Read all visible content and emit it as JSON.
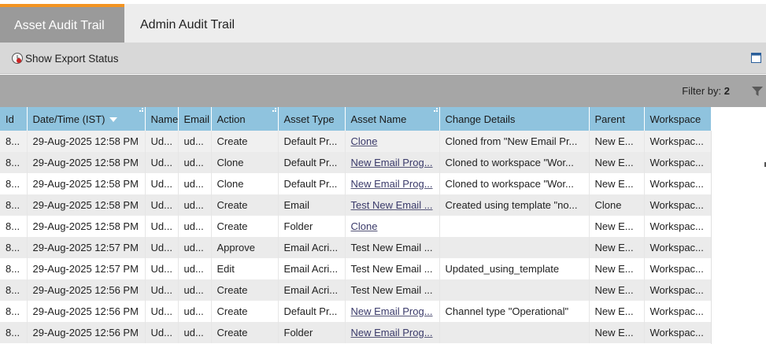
{
  "tabs": [
    {
      "label": "Asset Audit Trail",
      "active": true
    },
    {
      "label": "Admin Audit Trail",
      "active": false
    }
  ],
  "toolbar": {
    "export_label": "Show Export Status",
    "export_icon": "export-status-icon",
    "window_icon": "maximize-window-icon"
  },
  "filter": {
    "label": "Filter by:",
    "count": "2",
    "icon": "funnel-icon"
  },
  "colors": {
    "accent": "#f39421",
    "active_tab": "#9a9a9a",
    "header": "#8fc3de"
  },
  "grid": {
    "columns": [
      "Id",
      "Date/Time (IST)",
      "Name",
      "Email",
      "Action",
      "Asset Type",
      "Asset Name",
      "Change Details",
      "Parent",
      "Workspace"
    ],
    "sorted_column": "Date/Time (IST)",
    "rows": [
      {
        "id": "8...",
        "datetime": "29-Aug-2025 12:58 PM",
        "name": "Ud...",
        "email": "ud...",
        "action": "Create",
        "asset_type": "Default Pr...",
        "asset_name": "Clone",
        "asset_link": true,
        "change": "Cloned from \"New Email Pr...",
        "parent": "New E...",
        "workspace": "Workspac..."
      },
      {
        "id": "8...",
        "datetime": "29-Aug-2025 12:58 PM",
        "name": "Ud...",
        "email": "ud...",
        "action": "Clone",
        "asset_type": "Default Pr...",
        "asset_name": "New Email Prog...",
        "asset_link": true,
        "change": "Cloned to workspace \"Wor...",
        "parent": "New E...",
        "workspace": "Workspac..."
      },
      {
        "id": "8...",
        "datetime": "29-Aug-2025 12:58 PM",
        "name": "Ud...",
        "email": "ud...",
        "action": "Clone",
        "asset_type": "Default Pr...",
        "asset_name": "New Email Prog...",
        "asset_link": true,
        "change": "Cloned to workspace \"Wor...",
        "parent": "New E...",
        "workspace": "Workspac..."
      },
      {
        "id": "8...",
        "datetime": "29-Aug-2025 12:58 PM",
        "name": "Ud...",
        "email": "ud...",
        "action": "Create",
        "asset_type": "Email",
        "asset_name": "Test New Email ...",
        "asset_link": true,
        "change": "Created using template \"no...",
        "parent": "Clone",
        "workspace": "Workspac..."
      },
      {
        "id": "8...",
        "datetime": "29-Aug-2025 12:58 PM",
        "name": "Ud...",
        "email": "ud...",
        "action": "Create",
        "asset_type": "Folder",
        "asset_name": "Clone",
        "asset_link": true,
        "change": "",
        "parent": "New E...",
        "workspace": "Workspac..."
      },
      {
        "id": "8...",
        "datetime": "29-Aug-2025 12:57 PM",
        "name": "Ud...",
        "email": "ud...",
        "action": "Approve",
        "asset_type": "Email Acri...",
        "asset_name": "Test New Email ...",
        "asset_link": false,
        "change": "",
        "parent": "New E...",
        "workspace": "Workspac..."
      },
      {
        "id": "8...",
        "datetime": "29-Aug-2025 12:57 PM",
        "name": "Ud...",
        "email": "ud...",
        "action": "Edit",
        "asset_type": "Email Acri...",
        "asset_name": "Test New Email ...",
        "asset_link": false,
        "change": "Updated_using_template",
        "parent": "New E...",
        "workspace": "Workspac..."
      },
      {
        "id": "8...",
        "datetime": "29-Aug-2025 12:56 PM",
        "name": "Ud...",
        "email": "ud...",
        "action": "Create",
        "asset_type": "Email Acri...",
        "asset_name": "Test New Email ...",
        "asset_link": false,
        "change": "",
        "parent": "New E...",
        "workspace": "Workspac..."
      },
      {
        "id": "8...",
        "datetime": "29-Aug-2025 12:56 PM",
        "name": "Ud...",
        "email": "ud...",
        "action": "Create",
        "asset_type": "Default Pr...",
        "asset_name": "New Email Prog...",
        "asset_link": true,
        "change": "Channel type \"Operational\"",
        "parent": "New E...",
        "workspace": "Workspac..."
      },
      {
        "id": "8...",
        "datetime": "29-Aug-2025 12:56 PM",
        "name": "Ud...",
        "email": "ud...",
        "action": "Create",
        "asset_type": "Folder",
        "asset_name": "New Email Prog...",
        "asset_link": true,
        "change": "",
        "parent": "New E...",
        "workspace": "Workspac..."
      }
    ]
  }
}
